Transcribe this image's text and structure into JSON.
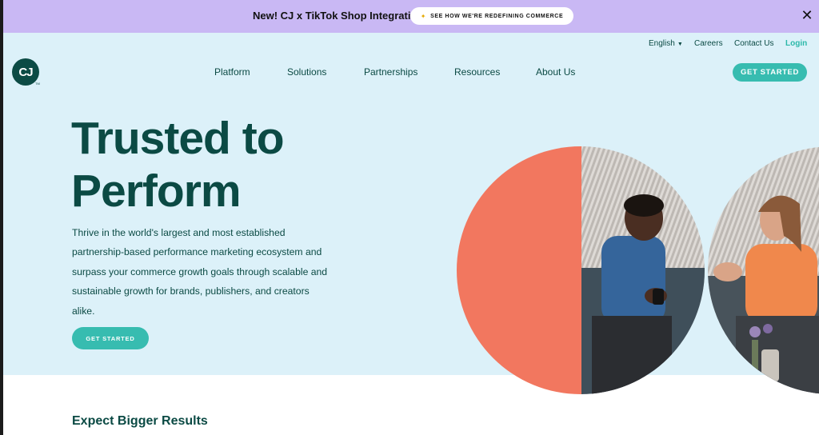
{
  "announcement": {
    "text": "New! CJ x TikTok Shop Integration",
    "cta_label": "SEE HOW WE'RE REDEFINING COMMERCE",
    "close_label": "✕"
  },
  "utility_nav": {
    "language": "English",
    "careers": "Careers",
    "contact": "Contact Us",
    "login": "Login"
  },
  "logo": {
    "text": "CJ",
    "tm": "TM"
  },
  "main_nav": {
    "items": [
      "Platform",
      "Solutions",
      "Partnerships",
      "Resources",
      "About Us"
    ],
    "cta_label": "GET STARTED"
  },
  "hero": {
    "headline_line1": "Trusted to",
    "headline_line2": "Perform",
    "body": "Thrive in the world's largest and most established partnership-based performance marketing ecosystem and surpass your commerce growth goals through scalable and sustainable growth for brands, publishers, and creators alike.",
    "cta_label": "GET STARTED"
  },
  "section": {
    "heading": "Expect Bigger Results"
  },
  "colors": {
    "announcement_bg": "#c9b8f4",
    "hero_bg": "#dcf1f9",
    "brand_dark": "#0b4a44",
    "accent_teal": "#37bcb0",
    "coral": "#f2775f"
  }
}
